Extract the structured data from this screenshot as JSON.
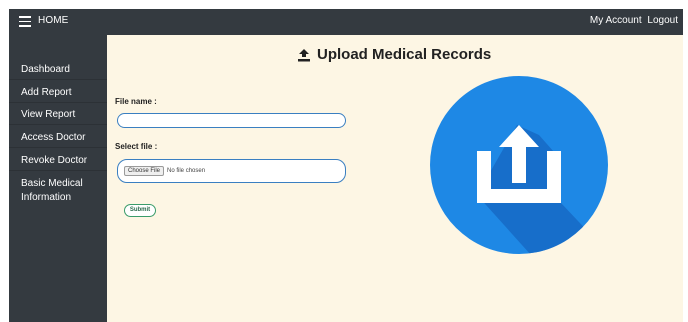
{
  "topbar": {
    "home_label": "HOME",
    "my_account": "My Account",
    "logout": "Logout"
  },
  "sidebar": {
    "items": [
      {
        "label": "Dashboard"
      },
      {
        "label": "Add Report"
      },
      {
        "label": "View Report"
      },
      {
        "label": "Access Doctor"
      },
      {
        "label": "Revoke Doctor"
      },
      {
        "label": "Basic Medical Information"
      }
    ]
  },
  "main": {
    "title": "Upload Medical Records",
    "file_name_label": "File name :",
    "file_name_value": "",
    "select_file_label": "Select file :",
    "choose_file_button": "Choose File",
    "no_file_text": "No file chosen",
    "submit_label": "Submit"
  },
  "colors": {
    "nav_bg": "#343a40",
    "content_bg": "#fdf6e4",
    "accent_blue": "#1e88e5",
    "input_border": "#3a7fc1"
  }
}
